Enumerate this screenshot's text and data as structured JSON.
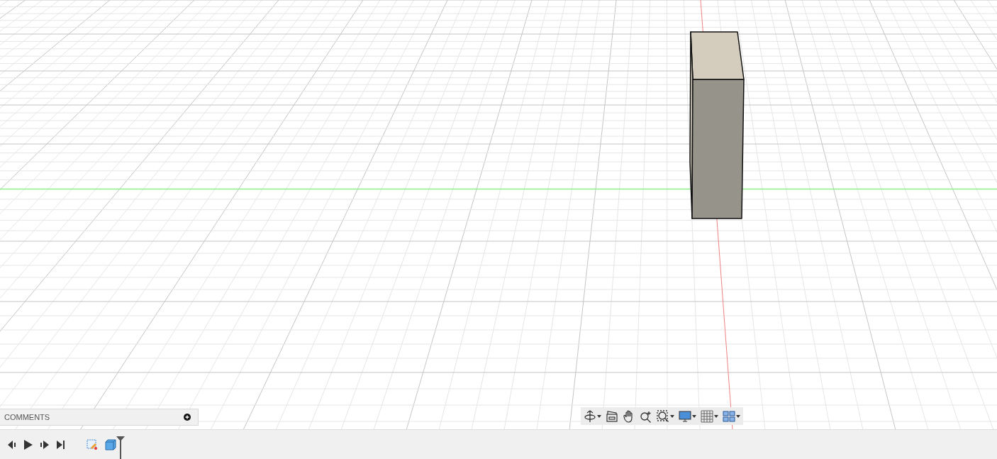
{
  "comments_panel": {
    "title": "COMMENTS"
  }
}
